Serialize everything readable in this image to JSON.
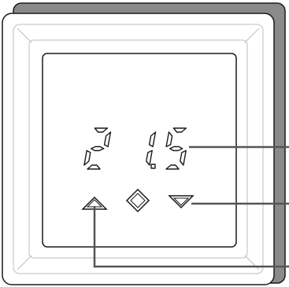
{
  "device": {
    "display_value": "21.5",
    "digits": [
      "2",
      "1",
      "5"
    ],
    "decimal_after_index": 1
  },
  "buttons": [
    {
      "name": "up",
      "icon": "triangle-up-icon"
    },
    {
      "name": "set",
      "icon": "diamond-icon"
    },
    {
      "name": "down",
      "icon": "triangle-down-icon"
    }
  ],
  "colors": {
    "frame_shadow": "#8a8a8a",
    "frame": "#ffffff",
    "outline": "#1a1a1a",
    "bevel_line": "#bdbdbd",
    "leader_line": "#555555",
    "segment_fill": "#ffffff"
  }
}
